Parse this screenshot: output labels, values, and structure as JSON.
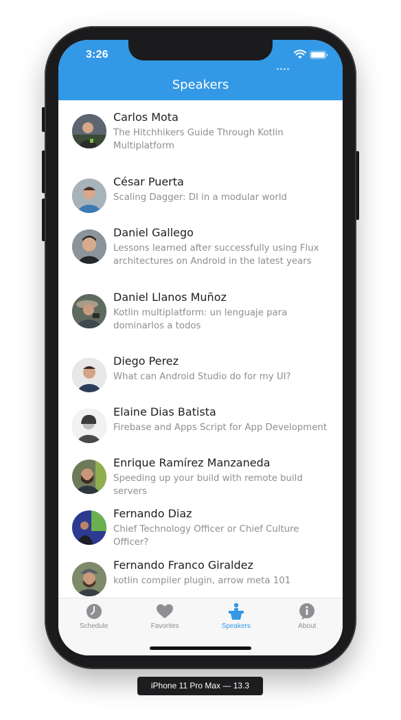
{
  "status_bar": {
    "time": "3:26"
  },
  "nav": {
    "title": "Speakers"
  },
  "speakers": [
    {
      "name": "Carlos Mota",
      "talk": "The Hitchhikers Guide Through Kotlin Multiplatform"
    },
    {
      "name": "César Puerta",
      "talk": "Scaling Dagger: DI in a modular world"
    },
    {
      "name": "Daniel Gallego",
      "talk": "Lessons learned after successfully using Flux architectures on Android in the latest years"
    },
    {
      "name": "Daniel Llanos Muñoz",
      "talk": "Kotlin multiplatform: un lenguaje para dominarlos a todos"
    },
    {
      "name": "Diego Perez",
      "talk": "What can Android Studio do for my UI?"
    },
    {
      "name": "Elaine Dias Batista",
      "talk": "Firebase and Apps Script for App Development"
    },
    {
      "name": "Enrique Ramírez Manzaneda",
      "talk": "Speeding up your build with remote build servers"
    },
    {
      "name": "Fernando Diaz",
      "talk": "Chief Technology Officer or Chief Culture Officer?"
    },
    {
      "name": "Fernando Franco Giraldez",
      "talk": "kotlin compiler plugin, arrow meta 101"
    }
  ],
  "tabs": [
    {
      "label": "Schedule",
      "icon": "clock-icon",
      "active": false
    },
    {
      "label": "Favorites",
      "icon": "heart-icon",
      "active": false
    },
    {
      "label": "Speakers",
      "icon": "speaker-podium-icon",
      "active": true
    },
    {
      "label": "About",
      "icon": "info-icon",
      "active": false
    }
  ],
  "device_caption": "iPhone 11 Pro Max — 13.3",
  "colors": {
    "accent": "#3398e5",
    "tab_inactive": "#8e8e93",
    "subtitle": "#8e8e93"
  }
}
